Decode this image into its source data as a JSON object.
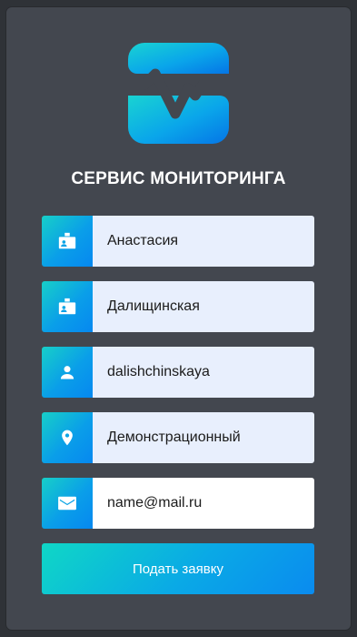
{
  "app": {
    "title": "СЕРВИС МОНИТОРИНГА",
    "logo_icon": "heartbeat-monitor-icon"
  },
  "colors": {
    "background": "#2f3237",
    "card": "#43474f",
    "accent_start": "#17cfc8",
    "accent_end": "#0688f0",
    "input_fill": "#e8effd"
  },
  "form": {
    "fields": [
      {
        "icon": "id-badge-icon",
        "value": "Анастасия"
      },
      {
        "icon": "id-badge-icon",
        "value": "Далищинская"
      },
      {
        "icon": "user-icon",
        "value": "dalishchinskaya"
      },
      {
        "icon": "location-pin-icon",
        "value": "Демонстрационный"
      },
      {
        "icon": "mail-icon",
        "value": "name@mail.ru"
      }
    ],
    "submit_label": "Подать заявку"
  }
}
